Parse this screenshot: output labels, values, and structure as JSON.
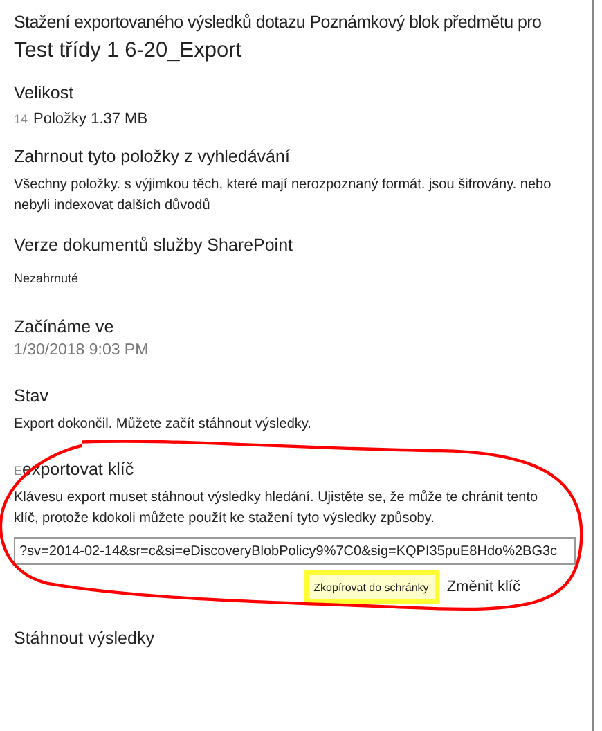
{
  "title_line_1": "Stažení exportovaného výsledků dotazu Poznámkový blok předmětu pro",
  "title_line_2": "Test třídy 1 6-20_Export",
  "size": {
    "label": "Velikost",
    "count": "14",
    "value": "Položky 1.37 MB"
  },
  "include": {
    "label": "Zahrnout tyto položky z vyhledávání",
    "value": "Všechny položky. s výjimkou těch, které mají nerozpoznaný formát. jsou šifrovány. nebo nebyli indexovat dalších důvodů"
  },
  "versions": {
    "label": "Verze dokumentů služby SharePoint",
    "value": "Nezahrnuté"
  },
  "started": {
    "label": "Začínáme ve",
    "value": "1/30/2018 9:03 PM"
  },
  "status": {
    "label": "Stav",
    "value": "Export dokončil. Můžete začít stáhnout výsledky."
  },
  "export_key": {
    "label_mark": "E",
    "label": "exportovat klíč",
    "description": "Klávesu export muset stáhnout výsledky hledání. Ujistěte se, že může te chránit tento klíč, protože kdokoli můžete použít ke stažení tyto výsledky způsoby.",
    "key_value": "?sv=2014-02-14&sr=c&si=eDiscoveryBlobPolicy9%7C0&sig=KQPI35puE8Hdo%2BG3c",
    "copy_button": "Zkopírovat do schránky",
    "change_button": "Změnit klíč"
  },
  "download_label": "Stáhnout výsledky"
}
